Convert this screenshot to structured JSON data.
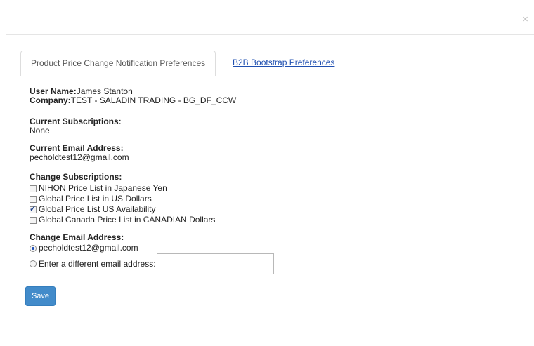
{
  "modal": {
    "close_glyph": "×"
  },
  "tabs": [
    {
      "label": "Product Price Change Notification Preferences",
      "active": true
    },
    {
      "label": "B2B Bootstrap Preferences",
      "active": false
    }
  ],
  "user": {
    "name_label": "User Name:",
    "name_value": "James Stanton",
    "company_label": "Company:",
    "company_value": "TEST - SALADIN TRADING - BG_DF_CCW"
  },
  "current_subscriptions": {
    "label": "Current Subscriptions:",
    "value": "None"
  },
  "current_email": {
    "label": "Current Email Address:",
    "value": "pecholdtest12@gmail.com"
  },
  "change_subscriptions": {
    "label": "Change Subscriptions:",
    "options": [
      {
        "label": "NIHON Price List in Japanese Yen",
        "checked": false
      },
      {
        "label": "Global Price List in US Dollars",
        "checked": false
      },
      {
        "label": "Global Price List US Availability",
        "checked": true
      },
      {
        "label": "Global Canada Price List in CANADIAN Dollars",
        "checked": false
      }
    ]
  },
  "change_email": {
    "label": "Change Email Address:",
    "option_current": "pecholdtest12@gmail.com",
    "option_other": "Enter a different email address:",
    "other_value": ""
  },
  "actions": {
    "save_label": "Save"
  },
  "colors": {
    "primary_button": "#428bca",
    "link": "#1f4fb0"
  }
}
